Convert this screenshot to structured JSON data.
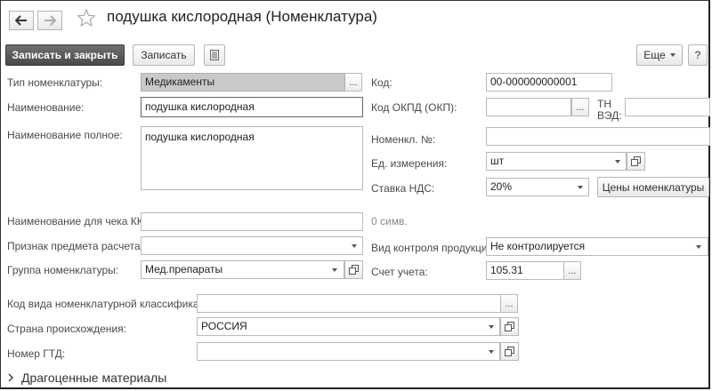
{
  "window": {
    "title": "подушка кислородная (Номенклатура)"
  },
  "toolbar": {
    "save_close": "Записать и закрыть",
    "save": "Записать",
    "more": "Еще",
    "help": "?"
  },
  "fields": {
    "type_label": "Тип номенклатуры:",
    "type_value": "Медикаменты",
    "name_label": "Наименование:",
    "name_value": "подушка кислородная",
    "fullname_label": "Наименование полное:",
    "fullname_value": "подушка кислородная",
    "kkm_label": "Наименование для чека ККМ:",
    "kkm_value": "",
    "kkm_count": "0 симв.",
    "subject_label": "Признак предмета расчета:",
    "subject_value": "",
    "group_label": "Группа номенклатуры:",
    "group_value": "Мед.препараты",
    "code_label": "Код:",
    "code_value": "00-000000000001",
    "okpd_label": "Код ОКПД (ОКП):",
    "okpd_value": "",
    "tnved_label_1": "ТН",
    "tnved_label_2": "ВЭД:",
    "tnved_value": "",
    "nomen_no_label": "Номенкл. №:",
    "nomen_no_value": "",
    "unit_label": "Ед. измерения:",
    "unit_value": "шт",
    "vat_label": "Ставка НДС:",
    "vat_value": "20%",
    "prices_button": "Цены номенклатуры",
    "control_label": "Вид контроля продукции:",
    "control_value": "Не контролируется",
    "account_label": "Счет учета:",
    "account_value": "105.31",
    "classif_label": "Код вида номенклатурной классификации:",
    "classif_value": "",
    "country_label": "Страна происхождения:",
    "country_value": "РОССИЯ",
    "gtd_label": "Номер ГТД:",
    "gtd_value": ""
  },
  "sections": {
    "precious": "Драгоценные материалы"
  },
  "icons": {
    "back": "arrow-left-icon",
    "forward": "arrow-right-icon",
    "favorite": "star-icon",
    "list": "list-icon",
    "open": "open-icon",
    "expand": "chevron-right-icon"
  }
}
